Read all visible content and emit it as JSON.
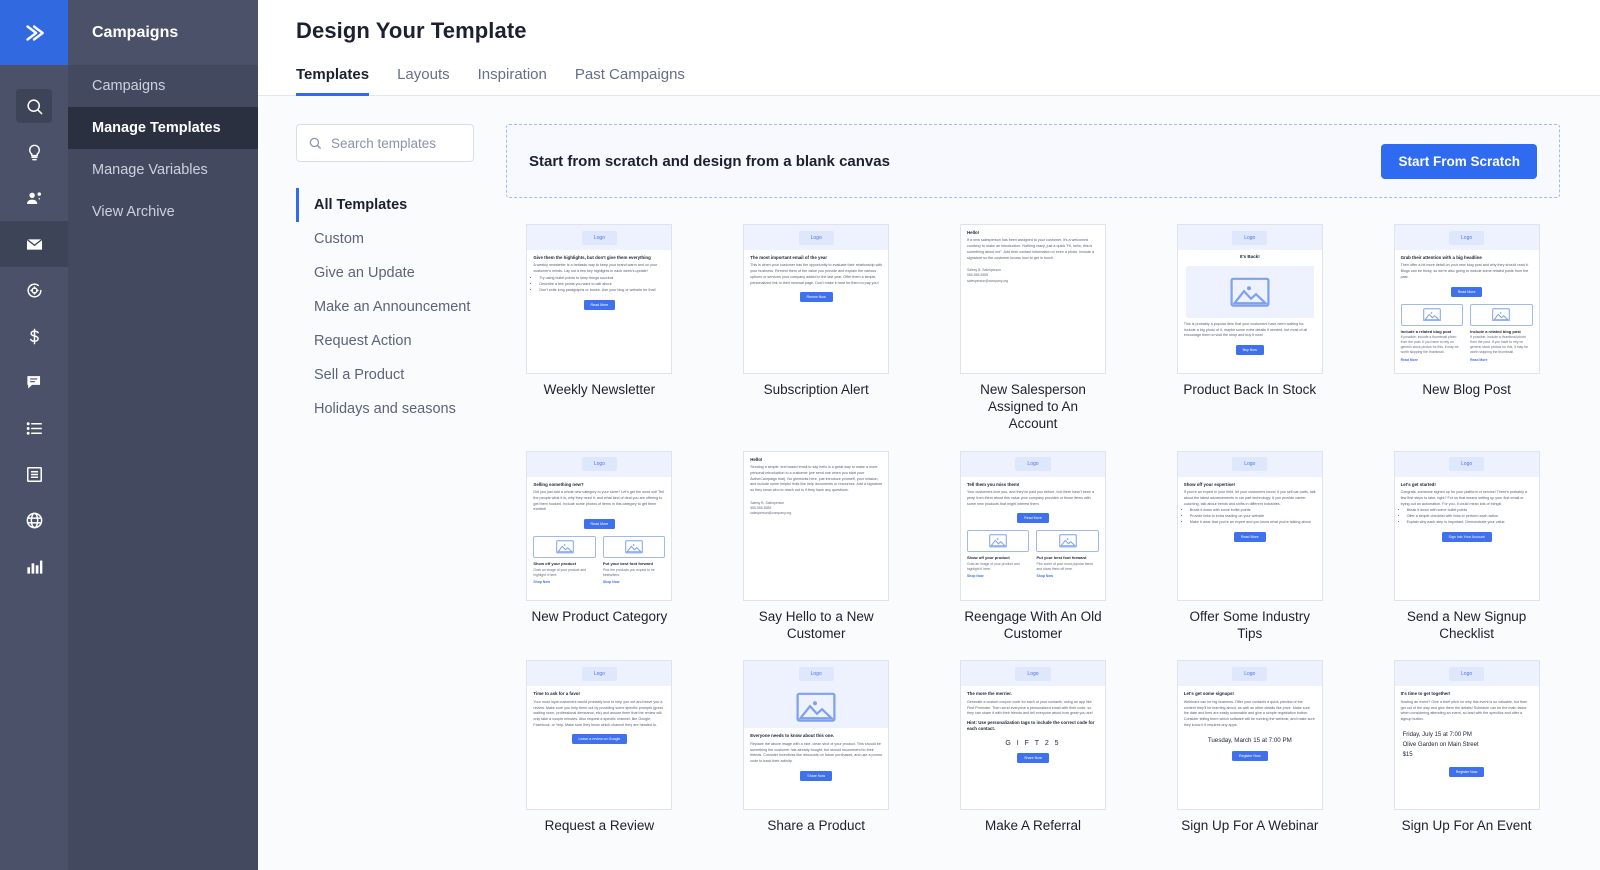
{
  "sidebar": {
    "logo_icon": "double-chevron-icon",
    "rail_icons": [
      {
        "name": "search-icon",
        "boxed": true
      },
      {
        "name": "lightbulb-icon",
        "boxed": false
      },
      {
        "name": "contacts-icon",
        "boxed": false
      },
      {
        "name": "envelope-icon",
        "boxed": true,
        "active": true
      },
      {
        "name": "automation-icon",
        "boxed": false
      },
      {
        "name": "dollar-icon",
        "boxed": false
      },
      {
        "name": "chat-icon",
        "boxed": false
      },
      {
        "name": "list-icon",
        "boxed": false
      },
      {
        "name": "pages-icon",
        "boxed": false
      },
      {
        "name": "globe-icon",
        "boxed": false
      },
      {
        "name": "bar-chart-icon",
        "boxed": false
      }
    ],
    "title": "Campaigns",
    "items": [
      {
        "label": "Campaigns",
        "active": false
      },
      {
        "label": "Manage Templates",
        "active": true
      },
      {
        "label": "Manage Variables",
        "active": false
      },
      {
        "label": "View Archive",
        "active": false
      }
    ]
  },
  "header": {
    "title": "Design Your Template",
    "tabs": [
      {
        "label": "Templates",
        "active": true
      },
      {
        "label": "Layouts",
        "active": false
      },
      {
        "label": "Inspiration",
        "active": false
      },
      {
        "label": "Past Campaigns",
        "active": false
      }
    ]
  },
  "search": {
    "placeholder": "Search templates",
    "value": "",
    "icon": "search-icon"
  },
  "categories": [
    {
      "label": "All Templates",
      "active": true
    },
    {
      "label": "Custom",
      "active": false
    },
    {
      "label": "Give an Update",
      "active": false
    },
    {
      "label": "Make an Announcement",
      "active": false
    },
    {
      "label": "Request Action",
      "active": false
    },
    {
      "label": "Sell a Product",
      "active": false
    },
    {
      "label": "Holidays and seasons",
      "active": false
    }
  ],
  "scratch": {
    "text": "Start from scratch and design from a blank canvas",
    "button": "Start From Scratch"
  },
  "colors": {
    "accent": "#2f6bf0",
    "sidebar": "#4a5168",
    "nav_panel": "#434a5f",
    "nav_active": "#2b3040",
    "page_bg": "#fafbfd"
  },
  "logo_chip_text": "Logo",
  "templates": [
    {
      "label": "Weekly Newsletter",
      "logo": true,
      "heading": "Give them the highlights, but don't give them everything",
      "paragraph": "A weekly newsletter is a fantastic way to keep your brand warm and on your customer's minds. Lay out a few key highlights in each week's update!",
      "bullets": [
        "Try using bullet points to keep things succinct",
        "Describe a few points you want to talk about",
        "Don't write long paragraphs or books. Use your blog or website for that!"
      ],
      "button": "Read More"
    },
    {
      "label": "Subscription Alert",
      "logo": true,
      "heading": "The most important email of the year",
      "paragraph": "This is when your customer has the opportunity to evaluate their relationship with your business. Remind them of the value you provide and explain the various options or services your company added in the last year. Offer them a simple, personalized link to their renewal page. Don't make it hard for them to pay you!",
      "button": "Renew Now"
    },
    {
      "label": "New Salesperson Assigned to An Account",
      "logo": false,
      "heading": "Hello!",
      "paragraph": "If a new salesperson has been assigned to your customer, it's a welcomed courtesy to make an introduction. Nothing crazy, just a quick \"Hi, hello, this is something about me\". Add their contact information or even a photo. Include a signature so the customer knows how to get in touch.",
      "signature": [
        "Salesy B. Salesperson",
        "555-555-5555",
        "salesperson@company.org"
      ]
    },
    {
      "label": "Product Back In Stock",
      "logo": true,
      "banner": "It's Back!",
      "image": true,
      "paragraph": "This is probably a popular item that your customers have been waiting for. Include a big photo of it, maybe some extra details if needed, but most of all encourage them to visit the shop and buy it now!",
      "button": "Buy Now"
    },
    {
      "label": "New Blog Post",
      "logo": true,
      "heading": "Grab their attention with a big headline",
      "paragraph": "Then offer a bit more detail on your new blog post and why they should read it. Blogs can be tricky, so we're also going to include some related posts from the past.",
      "button": "Read More",
      "columns": [
        {
          "sub": "Include a related blog post",
          "text": "If possible, include a thumbnail photo from the post. If you have to rely on generic stock photos for this, it may be worth skipping the thumbnail.",
          "link": "Read More"
        },
        {
          "sub": "Include a related blog post",
          "text": "If possible, include a thumbnail photo from the post. If you have to rely on generic stock photos for this, it may be worth skipping the thumbnail.",
          "link": "Read More"
        }
      ]
    },
    {
      "label": "New Product Category",
      "logo": true,
      "heading": "Selling something new?",
      "paragraph": "Did you just add a whole new category to your store? Let's get the word out! Tell the people what it is, why they need it, and what kind of deal you are offering to get them hooked. Include some photos of items in this category to get them excited!",
      "button": "Read More",
      "columns": [
        {
          "sub": "Show off your product",
          "text": "Grab an image of your product and highlight it here.",
          "link": "Shop Now"
        },
        {
          "sub": "Put your best foot forward",
          "text": "Pick the products you expect to be bestsellers.",
          "link": "Shop Now"
        }
      ]
    },
    {
      "label": "Say Hello to a New Customer",
      "logo": false,
      "heading": "Hello!",
      "paragraph": "Sending a simple, text based email to say hello is a great way to make a more personal introduction to a customer (we send one when you start your ActiveCampaign trial). No gimmicks here, just introduce yourself, your mission, and include some helpful links like help documents or resources. Add a signature so they know who to reach out to if they have any questions.",
      "signature": [
        "Salesy B. Salesperson",
        "555-555-5555",
        "salesperson@company.org"
      ]
    },
    {
      "label": "Reengage With An Old Customer",
      "logo": true,
      "heading": "Tell them you miss them!",
      "paragraph": "Your customers love you, and they've paid you before, but there hasn't been a peep from them about this value your company provides or these items with some new products that might interest them.",
      "button": "Read More",
      "columns": [
        {
          "sub": "Show off your product",
          "text": "Grab an image of your product and highlight it here.",
          "link": "Shop Now"
        },
        {
          "sub": "Put your best foot forward",
          "text": "Pick some of your most popular items and show them off here.",
          "link": "Shop Now"
        }
      ]
    },
    {
      "label": "Offer Some Industry Tips",
      "logo": true,
      "heading": "Show off your expertise!",
      "paragraph": "If you're an expert in your field, let your customers know! If you sell car parts, talk about the latest advancements in car part technology. If you provide career coaching, talk about trends and shifts in different industries.",
      "bullets": [
        "Break it down with some bullet points",
        "Provide links to extra reading on your website",
        "Make it clear that you're an expert and you know what you're talking about"
      ],
      "button": "Read More"
    },
    {
      "label": "Send a New Signup Checklist",
      "logo": true,
      "heading": "Let's get started!",
      "paragraph": "Congrats, someone signed up for your platform or service! There's probably a few first steps to take, right? For us that means setting up your first email or trying out an automation. For you, it could mean lots of things!",
      "bullets": [
        "Break it down with some bullet points",
        "Offer a simple checklist with links to perform each action",
        "Explain why each step is important. Demonstrate your value"
      ],
      "button": "Sign Into Your Account"
    },
    {
      "label": "Request a Review",
      "logo": true,
      "heading": "Time to ask for a favor",
      "paragraph": "Your most loyal customers would probably love to help you out and leave you a review. Make sure you help them out by providing some specific prompts (great waiting room, professional demeanor, etc) and assure them that the review will only take a couple minutes. Also request a specific channel, like Google, Facebook, or Yelp. Make sure they know which channel they are headed to.",
      "button": "Leave a review on Google"
    },
    {
      "label": "Share a Product",
      "logo": true,
      "image_band": true,
      "heading": "Everyone needs to know about this one.",
      "paragraph": "Replace the above image with a nice, clean shot of your product. This should be something the customer has already bought, but should recommend to their friends. Consider incentives like discounts on future purchases, and use a promo code to track their activity.",
      "button": "Share Now"
    },
    {
      "label": "Make A Referral",
      "logo": true,
      "heading": "The more the merrier.",
      "paragraph": "Generate a custom coupon code for each of your contacts, using an app like First Promoter. Then send everyone a personalized email with their code, so they can share it with their friends and tell everyone about how great you are!",
      "hint": "Hint: Use personalization tags to include the correct code for each contact.",
      "coupon": "G I F T 2 5",
      "button": "Share Now"
    },
    {
      "label": "Sign Up For A Webinar",
      "logo": true,
      "heading": "Let's get some signups!",
      "paragraph": "Webinars can be big business. Offer your contacts a quick preview of the content they'll be learning about, as well as other details like price. Make sure the date and time are easily scannable and give a simple registration button. Consider telling them which software will be running the webinar, and make sure they know if it requires any apps.",
      "date": "Tuesday, March 15 at 7:00 PM",
      "button": "Register Now"
    },
    {
      "label": "Sign Up For An Event",
      "logo": true,
      "heading": "It's time to get together!",
      "paragraph": "Hosting an event? Give a brief pitch on why this event is so valuable, but then get out of the way and give them the details! Schedule can be the main factor when considering attending an event, so lead with the specifics and offer a signup button.",
      "details": [
        "Friday, July 15 at 7:00 PM",
        "Olive Garden on Main Street",
        "$15"
      ],
      "button": "Register Now"
    }
  ]
}
